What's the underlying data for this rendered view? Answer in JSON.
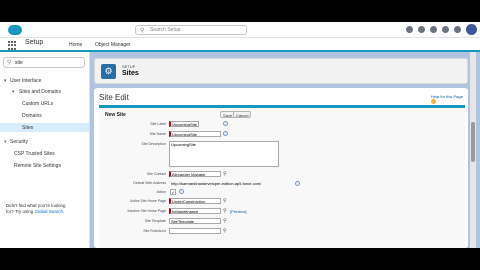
{
  "header": {
    "search_placeholder": "Search Setup",
    "icons": [
      "star-icon",
      "plus-icon",
      "help-icon",
      "gear-icon",
      "bell-icon",
      "avatar"
    ]
  },
  "app_nav": {
    "app_name": "Setup",
    "tabs": [
      {
        "label": "Home"
      },
      {
        "label": "Object Manager"
      }
    ]
  },
  "sidebar": {
    "quick_find_value": "site",
    "items": {
      "user_interface": "User Interface",
      "sites_and_domains": "Sites and Domains",
      "custom_urls": "Custom URLs",
      "domains": "Domains",
      "sites": "Sites",
      "security": "Security",
      "csp_trusted_sites": "CSP Trusted Sites",
      "remote_site_settings": "Remote Site Settings"
    },
    "footer_text": "Didn't find what you're looking for? Try using Global Search.",
    "footer_line1": "Didn't find what you're looking",
    "footer_line2a": "for? Try using",
    "footer_link": "Global Search"
  },
  "page_header": {
    "eyebrow": "SETUP",
    "title": "Sites"
  },
  "edit": {
    "title": "Site Edit",
    "help_link": "Help for this Page",
    "section_title": "New Site",
    "save_label": "Save",
    "cancel_label": "Cancel",
    "fields": {
      "site_label": {
        "label": "Site Label",
        "value": "UpcomingSite"
      },
      "site_name": {
        "label": "Site Name",
        "value": "UpcomingSite"
      },
      "site_description": {
        "label": "Site Description",
        "value": "UpcomingSite"
      },
      "site_contact": {
        "label": "Site Contact",
        "value": "Alexander Mahabir"
      },
      "default_web_address": {
        "label": "Default Web Address",
        "value": "http://kamrankhandeveloper-edition.ap5.force.com/"
      },
      "active": {
        "label": "Active",
        "checked": true
      },
      "active_home_page": {
        "label": "Active Site Home Page",
        "value": "UnderConstruction"
      },
      "inactive_home_page": {
        "label": "Inactive Site Home Page",
        "value": "InMaintenance",
        "preview": "[Preview]"
      },
      "site_template": {
        "label": "Site Template",
        "value": "SiteTemplate"
      },
      "site_robots": {
        "label": "Site Robots.txt",
        "value": ""
      }
    }
  },
  "colors": {
    "brand": "#1798c1",
    "content_bg": "#b0c4df",
    "required": "#cc0000"
  }
}
